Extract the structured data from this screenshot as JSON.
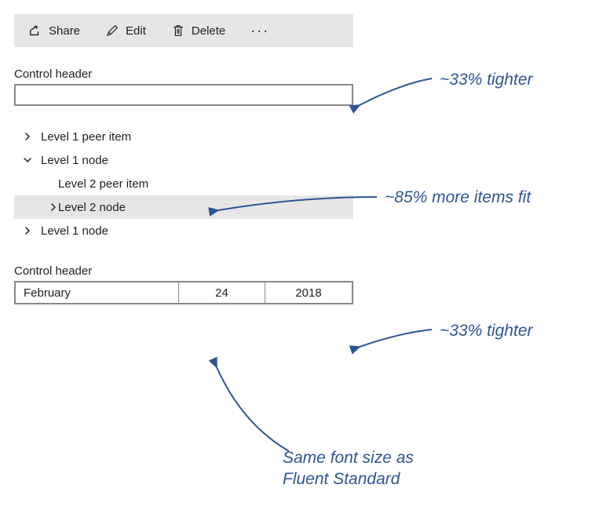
{
  "commandbar": {
    "share": "Share",
    "edit": "Edit",
    "delete": "Delete"
  },
  "textbox": {
    "label": "Control header"
  },
  "tree": {
    "items": [
      {
        "label": "Level 1 peer item"
      },
      {
        "label": "Level 1 node"
      },
      {
        "label": "Level 2 peer item"
      },
      {
        "label": "Level 2 node"
      },
      {
        "label": "Level 1 node"
      }
    ]
  },
  "date": {
    "label": "Control header",
    "month": "February",
    "day": "24",
    "year": "2018"
  },
  "annotations": {
    "tighter1": "~33% tighter",
    "moreitems": "~85% more items fit",
    "tighter2": "~33% tighter",
    "fontsize": "Same font size as Fluent Standard"
  }
}
